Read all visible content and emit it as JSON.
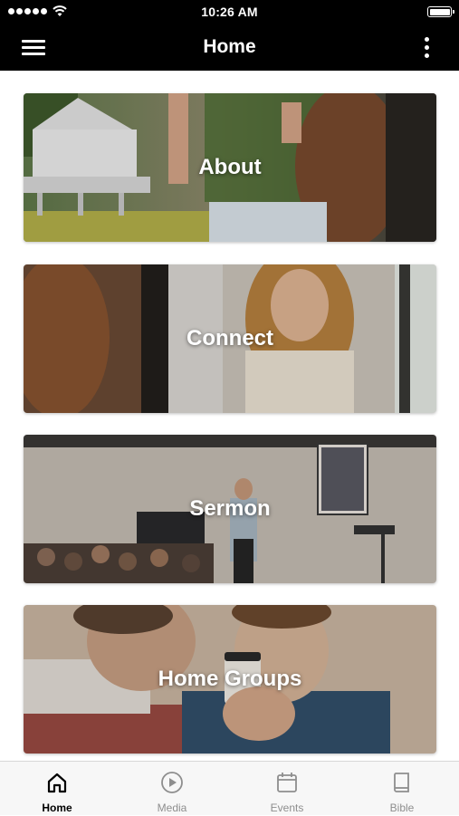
{
  "status_bar": {
    "time": "10:26 AM"
  },
  "nav": {
    "title": "Home"
  },
  "cards": [
    {
      "title": "About"
    },
    {
      "title": "Connect"
    },
    {
      "title": "Sermon"
    },
    {
      "title": "Home Groups"
    }
  ],
  "tabs": [
    {
      "label": "Home",
      "icon": "home-icon",
      "active": true
    },
    {
      "label": "Media",
      "icon": "play-circle-icon",
      "active": false
    },
    {
      "label": "Events",
      "icon": "calendar-icon",
      "active": false
    },
    {
      "label": "Bible",
      "icon": "book-icon",
      "active": false
    }
  ],
  "colors": {
    "bar_bg": "#000000",
    "tab_active": "#000000",
    "tab_inactive": "#8e8e8e"
  }
}
